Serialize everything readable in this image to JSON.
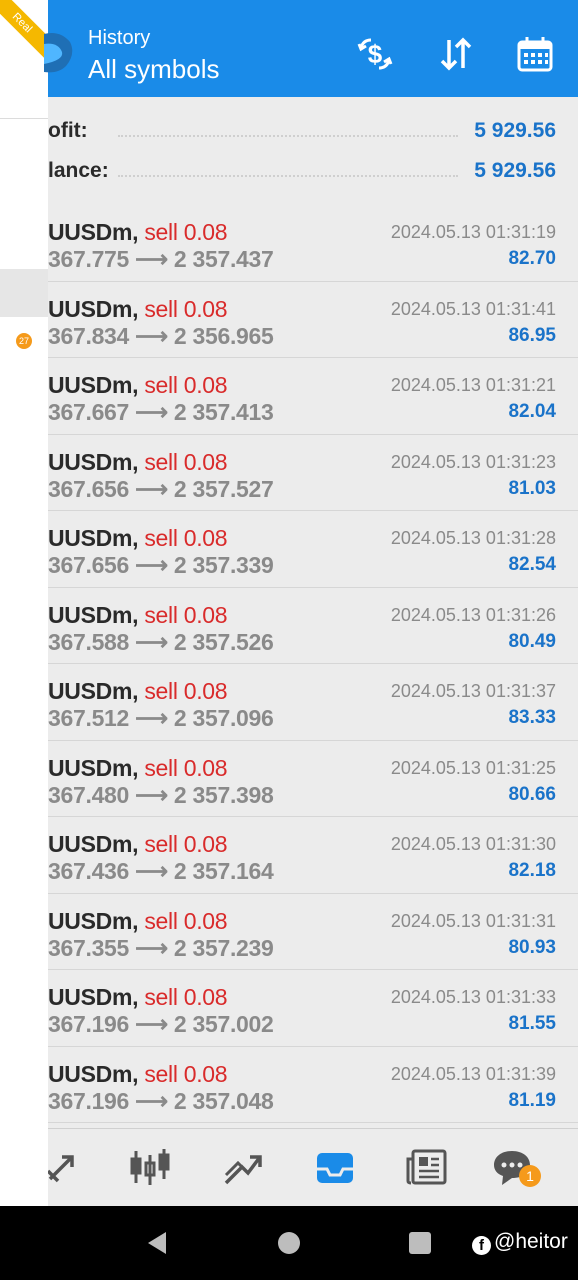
{
  "header": {
    "subtitle": "History",
    "title": "All symbols",
    "icons": [
      "currency-exchange-icon",
      "sort-icon",
      "calendar-icon"
    ]
  },
  "summary": {
    "profit_label": "ofit:",
    "profit_value": "5 929.56",
    "balance_label": "lance:",
    "balance_value": "5 929.56"
  },
  "trades": [
    {
      "symbol": "UUSDm,",
      "side": "sell 0.08",
      "prices": "367.775 ⟶ 2 357.437",
      "time": "2024.05.13 01:31:19",
      "profit": "82.70"
    },
    {
      "symbol": "UUSDm,",
      "side": "sell 0.08",
      "prices": "367.834 ⟶ 2 356.965",
      "time": "2024.05.13 01:31:41",
      "profit": "86.95"
    },
    {
      "symbol": "UUSDm,",
      "side": "sell 0.08",
      "prices": "367.667 ⟶ 2 357.413",
      "time": "2024.05.13 01:31:21",
      "profit": "82.04"
    },
    {
      "symbol": "UUSDm,",
      "side": "sell 0.08",
      "prices": "367.656 ⟶ 2 357.527",
      "time": "2024.05.13 01:31:23",
      "profit": "81.03"
    },
    {
      "symbol": "UUSDm,",
      "side": "sell 0.08",
      "prices": "367.656 ⟶ 2 357.339",
      "time": "2024.05.13 01:31:28",
      "profit": "82.54"
    },
    {
      "symbol": "UUSDm,",
      "side": "sell 0.08",
      "prices": "367.588 ⟶ 2 357.526",
      "time": "2024.05.13 01:31:26",
      "profit": "80.49"
    },
    {
      "symbol": "UUSDm,",
      "side": "sell 0.08",
      "prices": "367.512 ⟶ 2 357.096",
      "time": "2024.05.13 01:31:37",
      "profit": "83.33"
    },
    {
      "symbol": "UUSDm,",
      "side": "sell 0.08",
      "prices": "367.480 ⟶ 2 357.398",
      "time": "2024.05.13 01:31:25",
      "profit": "80.66"
    },
    {
      "symbol": "UUSDm,",
      "side": "sell 0.08",
      "prices": "367.436 ⟶ 2 357.164",
      "time": "2024.05.13 01:31:30",
      "profit": "82.18"
    },
    {
      "symbol": "UUSDm,",
      "side": "sell 0.08",
      "prices": "367.355 ⟶ 2 357.239",
      "time": "2024.05.13 01:31:31",
      "profit": "80.93"
    },
    {
      "symbol": "UUSDm,",
      "side": "sell 0.08",
      "prices": "367.196 ⟶ 2 357.002",
      "time": "2024.05.13 01:31:33",
      "profit": "81.55"
    },
    {
      "symbol": "UUSDm,",
      "side": "sell 0.08",
      "prices": "367.196 ⟶ 2 357.048",
      "time": "2024.05.13 01:31:39",
      "profit": "81.19"
    }
  ],
  "tabbar": {
    "tabs": [
      "quotes-icon",
      "chart-candles-icon",
      "trade-icon",
      "history-inbox-icon",
      "news-icon",
      "chat-icon"
    ],
    "active": "history-inbox-icon",
    "chat_badge": "1"
  },
  "drawer": {
    "ribbon": "Real",
    "badge": "27"
  },
  "navbar": {
    "watermark": "@heitor"
  },
  "colors": {
    "header": "#1a8be8",
    "profit": "#1a73c9",
    "sell": "#d92b2b",
    "badge": "#f59a1b"
  }
}
